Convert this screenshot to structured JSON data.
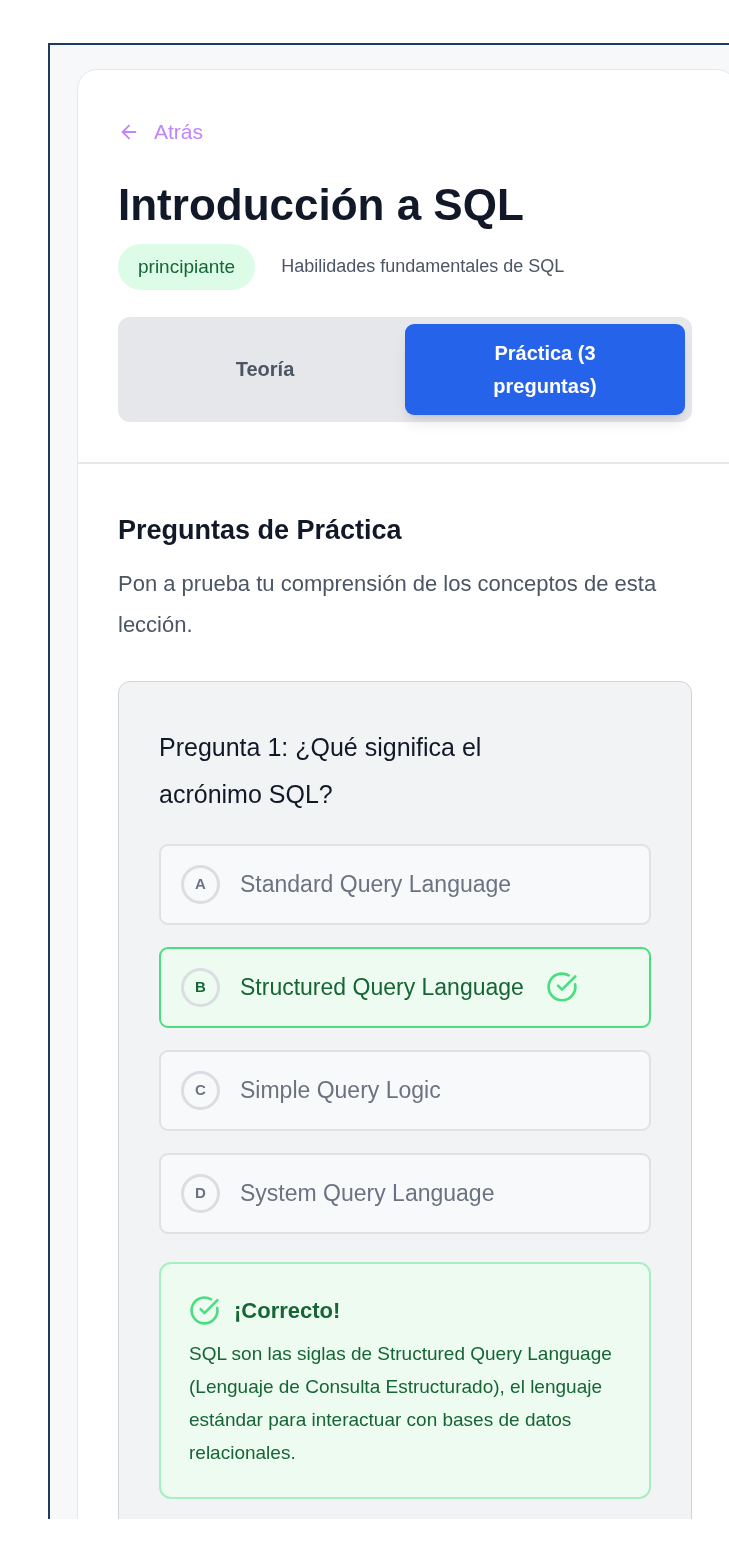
{
  "back_link": "Atrás",
  "title": "Introducción a SQL",
  "badge": "principiante",
  "subtitle": "Habilidades fundamentales de SQL",
  "tabs": [
    {
      "label": "Teoría",
      "selected": false
    },
    {
      "label": "Práctica (3 preguntas)",
      "selected": true
    }
  ],
  "section": {
    "heading": "Preguntas de Práctica",
    "description": "Pon a prueba tu comprensión de los conceptos de esta lección."
  },
  "question": {
    "text": "Pregunta 1: ¿Qué significa el acrónimo SQL?",
    "options": [
      {
        "letter": "A",
        "text": "Standard Query Language",
        "selected": false
      },
      {
        "letter": "B",
        "text": "Structured Query Language",
        "selected": true
      },
      {
        "letter": "C",
        "text": "Simple Query Logic",
        "selected": false
      },
      {
        "letter": "D",
        "text": "System Query Language",
        "selected": false
      }
    ],
    "feedback": {
      "title": "¡Correcto!",
      "text": "SQL son las siglas de Structured Query Language (Lenguaje de Consulta Estructurado), el lenguaje estándar para interactuar con bases de datos relacionales."
    }
  }
}
